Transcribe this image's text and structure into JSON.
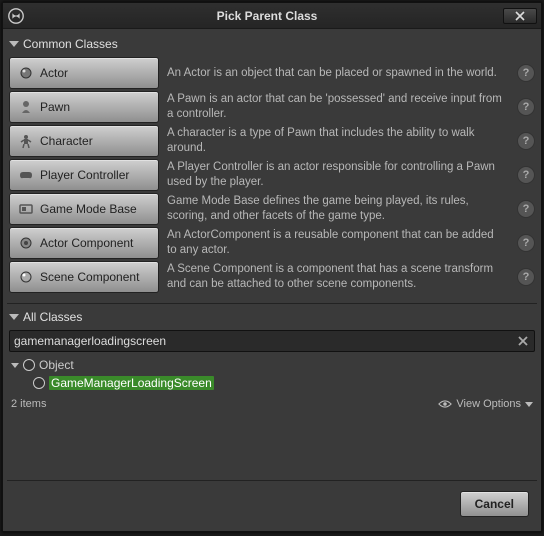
{
  "title": "Pick Parent Class",
  "sections": {
    "common": "Common Classes",
    "all": "All Classes"
  },
  "common_classes": [
    {
      "name": "Actor",
      "desc": "An Actor is an object that can be placed or spawned in the world."
    },
    {
      "name": "Pawn",
      "desc": "A Pawn is an actor that can be 'possessed' and receive input from a controller."
    },
    {
      "name": "Character",
      "desc": "A character is a type of Pawn that includes the ability to walk around."
    },
    {
      "name": "Player Controller",
      "desc": "A Player Controller is an actor responsible for controlling a Pawn used by the player."
    },
    {
      "name": "Game Mode Base",
      "desc": "Game Mode Base defines the game being played, its rules, scoring, and other facets of the game type."
    },
    {
      "name": "Actor Component",
      "desc": "An ActorComponent is a reusable component that can be added to any actor."
    },
    {
      "name": "Scene Component",
      "desc": "A Scene Component is a component that has a scene transform and can be attached to other scene components."
    }
  ],
  "search_value": "gamemanagerloadingscreen",
  "tree": {
    "root": "Object",
    "child": "GameManagerLoadingScreen"
  },
  "item_count_label": "2 items",
  "view_options_label": "View Options",
  "cancel_label": "Cancel"
}
